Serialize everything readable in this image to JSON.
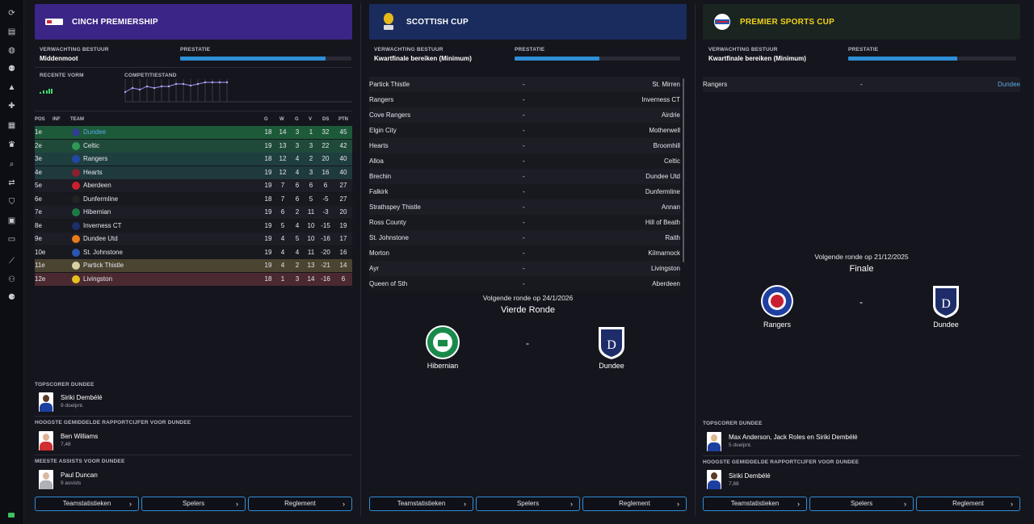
{
  "sidebar": {
    "icons": [
      "refresh-icon",
      "inbox-icon",
      "globe-icon",
      "squad-icon",
      "tactics-icon",
      "medical-icon",
      "calendar-icon",
      "trophy-icon",
      "search-icon",
      "transfer-icon",
      "shield-icon",
      "finance-icon",
      "ticket-icon",
      "training-icon",
      "staff-icon",
      "scouting-icon"
    ]
  },
  "league": {
    "title": "CINCH PREMIERSHIP",
    "header_color": "#3b2586",
    "expectation_label": "VERWACHTING BESTUUR",
    "expectation_value": "Middenmoot",
    "performance_label": "PRESTATIE",
    "performance_fill": 0.88,
    "form_label": "RECENTE VORM",
    "standing_label": "COMPETITIESTAND",
    "columns": {
      "pos": "POS",
      "inf": "INF",
      "team": "TEAM",
      "g": "G",
      "w": "W",
      "d": "G",
      "l": "V",
      "gd": "DS",
      "pts": "PTN"
    },
    "rows": [
      {
        "pos": "1e",
        "team": "Dundee",
        "p": "18",
        "w": "14",
        "d": "3",
        "l": "1",
        "gd": "32",
        "pts": "45",
        "bg": "#1d5a3a",
        "crest": "#2f3f8f",
        "highlight": true
      },
      {
        "pos": "2e",
        "team": "Celtic",
        "p": "19",
        "w": "13",
        "d": "3",
        "l": "3",
        "gd": "22",
        "pts": "42",
        "bg": "#1f4a3a",
        "crest": "#2d9a55"
      },
      {
        "pos": "3e",
        "team": "Rangers",
        "p": "18",
        "w": "12",
        "d": "4",
        "l": "2",
        "gd": "20",
        "pts": "40",
        "bg": "#1f3f3f",
        "crest": "#2149a8"
      },
      {
        "pos": "4e",
        "team": "Hearts",
        "p": "19",
        "w": "12",
        "d": "4",
        "l": "3",
        "gd": "16",
        "pts": "40",
        "bg": "#1f3a3d",
        "crest": "#8a1f30"
      },
      {
        "pos": "5e",
        "team": "Aberdeen",
        "p": "19",
        "w": "7",
        "d": "6",
        "l": "6",
        "gd": "6",
        "pts": "27",
        "bg": "#1d1d26",
        "crest": "#c8202c"
      },
      {
        "pos": "6e",
        "team": "Dunfermline",
        "p": "18",
        "w": "7",
        "d": "6",
        "l": "5",
        "gd": "-5",
        "pts": "27",
        "bg": "#18181f",
        "crest": "#222222"
      },
      {
        "pos": "7e",
        "team": "Hibernian",
        "p": "19",
        "w": "6",
        "d": "2",
        "l": "11",
        "gd": "-3",
        "pts": "20",
        "bg": "#1d1d26",
        "crest": "#1e7a45"
      },
      {
        "pos": "8e",
        "team": "Inverness CT",
        "p": "19",
        "w": "5",
        "d": "4",
        "l": "10",
        "gd": "-15",
        "pts": "19",
        "bg": "#18181f",
        "crest": "#1d2f6a"
      },
      {
        "pos": "9e",
        "team": "Dundee Utd",
        "p": "19",
        "w": "4",
        "d": "5",
        "l": "10",
        "gd": "-16",
        "pts": "17",
        "bg": "#1d1d26",
        "crest": "#e87a1a"
      },
      {
        "pos": "10e",
        "team": "St. Johnstone",
        "p": "19",
        "w": "4",
        "d": "4",
        "l": "11",
        "gd": "-20",
        "pts": "16",
        "bg": "#18181f",
        "crest": "#2a55b0"
      },
      {
        "pos": "11e",
        "team": "Partick Thistle",
        "p": "19",
        "w": "4",
        "d": "2",
        "l": "13",
        "gd": "-21",
        "pts": "14",
        "bg": "#4a4430",
        "crest": "#d8d0a0"
      },
      {
        "pos": "12e",
        "team": "Livingston",
        "p": "18",
        "w": "1",
        "d": "3",
        "l": "14",
        "gd": "-16",
        "pts": "6",
        "bg": "#4a2a30",
        "crest": "#e8c020"
      }
    ],
    "topscorer_label": "TOPSCORER DUNDEE",
    "topscorer_name": "Siriki Dembélé",
    "topscorer_sub": "9 doelpnt.",
    "rating_label": "HOOGSTE GEMIDDELDE RAPPORTCIJFER VOOR DUNDEE",
    "rating_name": "Ben Williams",
    "rating_sub": "7,48",
    "assists_label": "MEESTE ASSISTS VOOR DUNDEE",
    "assists_name": "Paul Duncan",
    "assists_sub": "9 assists"
  },
  "cup": {
    "title": "SCOTTISH CUP",
    "header_color": "#1a2c5e",
    "expectation_label": "VERWACHTING BESTUUR",
    "expectation_value": "Kwartfinale bereiken (Minimum)",
    "performance_label": "PRESTATIE",
    "performance_fill": 0.5,
    "fixtures": [
      {
        "home": "Partick Thistle",
        "sep": "-",
        "away": "St. Mirren"
      },
      {
        "home": "Rangers",
        "sep": "-",
        "away": "Inverness CT"
      },
      {
        "home": "Cove Rangers",
        "sep": "-",
        "away": "Airdrie"
      },
      {
        "home": "Elgin City",
        "sep": "-",
        "away": "Motherwell"
      },
      {
        "home": "Hearts",
        "sep": "-",
        "away": "Broomhill"
      },
      {
        "home": "Alloa",
        "sep": "-",
        "away": "Celtic"
      },
      {
        "home": "Brechin",
        "sep": "-",
        "away": "Dundee Utd"
      },
      {
        "home": "Falkirk",
        "sep": "-",
        "away": "Dunfermline"
      },
      {
        "home": "Strathspey Thistle",
        "sep": "-",
        "away": "Annan"
      },
      {
        "home": "Ross County",
        "sep": "-",
        "away": "Hill of Beath"
      },
      {
        "home": "St. Johnstone",
        "sep": "-",
        "away": "Raith"
      },
      {
        "home": "Morton",
        "sep": "-",
        "away": "Kilmarnock"
      },
      {
        "home": "Ayr",
        "sep": "-",
        "away": "Livingston"
      },
      {
        "home": "Queen of Sth",
        "sep": "-",
        "away": "Aberdeen"
      }
    ],
    "next_round_date": "Volgende ronde op 24/1/2026",
    "next_round_name": "Vierde Ronde",
    "home_team": "Hibernian",
    "away_team": "Dundee",
    "vs": "-"
  },
  "league_cup": {
    "title": "PREMIER SPORTS CUP",
    "title_color": "#f2d21b",
    "header_color": "#1a2420",
    "expectation_label": "VERWACHTING BESTUUR",
    "expectation_value": "Kwartfinale bereiken (Minimum)",
    "performance_label": "PRESTATIE",
    "performance_fill": 0.65,
    "fixture": {
      "home": "Rangers",
      "sep": "-",
      "away": "Dundee"
    },
    "next_round_date": "Volgende ronde op 21/12/2025",
    "next_round_name": "Finale",
    "home_team": "Rangers",
    "away_team": "Dundee",
    "vs": "-",
    "topscorer_label": "TOPSCORER DUNDEE",
    "topscorer_name": "Max Anderson, Jack Roles en Siriki Dembélé",
    "topscorer_sub": "5 doelpnt.",
    "rating_label": "HOOGSTE GEMIDDELDE RAPPORTCIJFER VOOR DUNDEE",
    "rating_name": "Siriki Dembélé",
    "rating_sub": "7,88"
  },
  "buttons": {
    "team_stats": "Teamstatistieken",
    "players": "Spelers",
    "rules": "Reglement"
  },
  "colors": {
    "accent": "#2f8fd6",
    "link": "#5aa9e6",
    "form_green": "#3fdc6f"
  }
}
